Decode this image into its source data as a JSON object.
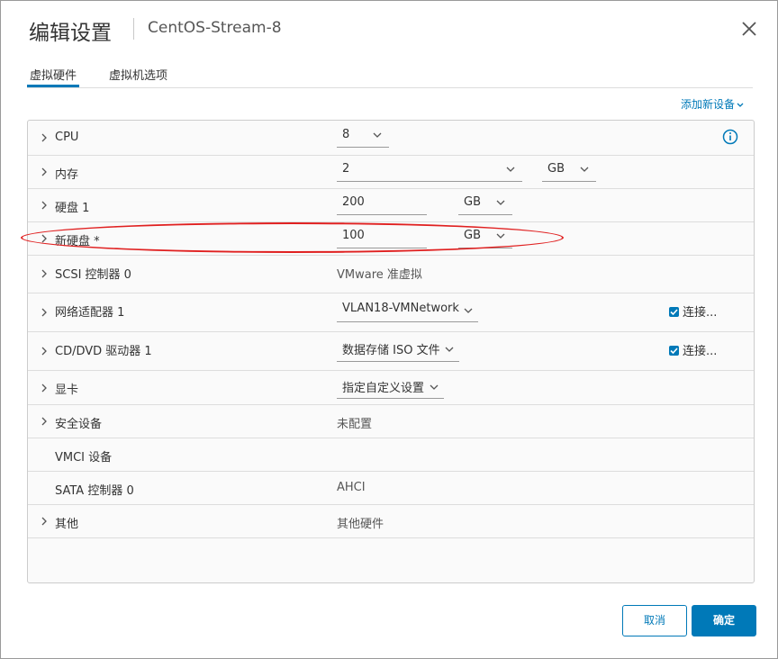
{
  "header": {
    "title": "编辑设置",
    "subtitle": "CentOS-Stream-8"
  },
  "tabs": [
    {
      "label": "虚拟硬件",
      "active": true
    },
    {
      "label": "虚拟机选项",
      "active": false
    }
  ],
  "add_device_label": "添加新设备",
  "rows": {
    "cpu": {
      "label": "CPU",
      "value": "8"
    },
    "memory": {
      "label": "内存",
      "value": "2",
      "unit": "GB"
    },
    "disk1": {
      "label": "硬盘 1",
      "value": "200",
      "unit": "GB"
    },
    "newdisk": {
      "label": "新硬盘 *",
      "value": "100",
      "unit": "GB"
    },
    "scsi": {
      "label": "SCSI 控制器 0",
      "value": "VMware 准虚拟"
    },
    "network": {
      "label": "网络适配器 1",
      "value": "VLAN18-VMNetwork",
      "connect_label": "连接..."
    },
    "cdrom": {
      "label": "CD/DVD 驱动器 1",
      "value": "数据存储 ISO 文件",
      "connect_label": "连接..."
    },
    "video": {
      "label": "显卡",
      "value": "指定自定义设置"
    },
    "security": {
      "label": "安全设备",
      "value": "未配置"
    },
    "vmci": {
      "label": "VMCI 设备"
    },
    "sata": {
      "label": "SATA 控制器 0",
      "value": "AHCI"
    },
    "other": {
      "label": "其他",
      "value": "其他硬件"
    }
  },
  "footer": {
    "cancel_label": "取消",
    "ok_label": "确定"
  },
  "colors": {
    "accent": "#0079b8",
    "highlight": "#e02020"
  }
}
